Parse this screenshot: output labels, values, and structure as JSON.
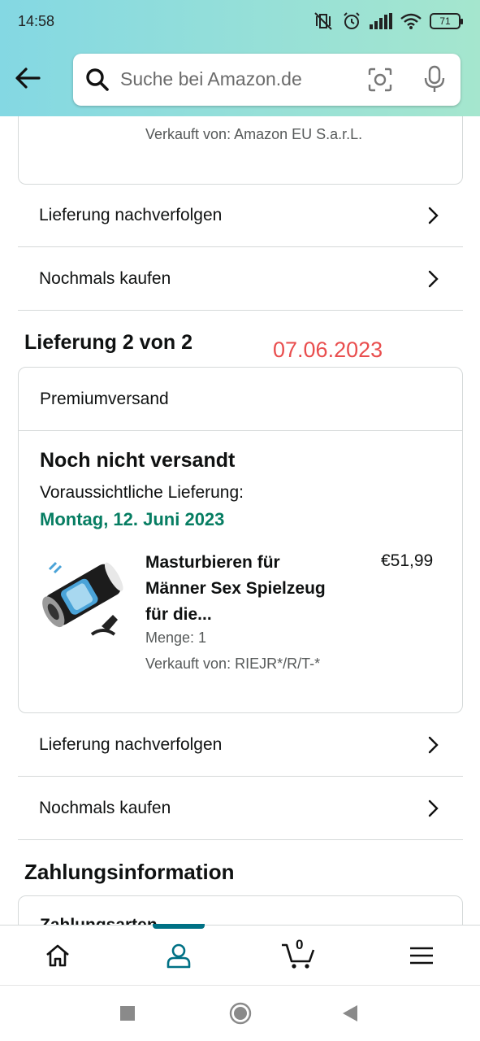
{
  "status_bar": {
    "time": "14:58",
    "battery": "71"
  },
  "search": {
    "placeholder": "Suche bei Amazon.de"
  },
  "delivery1": {
    "seller": "Verkauft von: Amazon EU S.a.r.L.",
    "track_label": "Lieferung nachverfolgen",
    "buy_again_label": "Nochmals kaufen"
  },
  "delivery2": {
    "title": "Lieferung 2 von 2",
    "annotation_date": "07.06.2023",
    "shipping_type": "Premiumversand",
    "status": "Noch nicht versandt",
    "expected_label": "Voraussichtliche Lieferung:",
    "expected_date": "Montag, 12. Juni 2023",
    "product": {
      "title": "Masturbieren für Männer Sex Spielzeug für die...",
      "price": "€51,99",
      "quantity": "Menge: 1",
      "seller": "Verkauft von: RIEJR*/R/T-*"
    },
    "track_label": "Lieferung nachverfolgen",
    "buy_again_label": "Nochmals kaufen"
  },
  "payment": {
    "title": "Zahlungsinformation",
    "methods_label": "Zahlungsarten"
  },
  "bottom_nav": {
    "cart_count": "0"
  },
  "colors": {
    "header_start": "#84d8e3",
    "header_end": "#a5e6ce",
    "delivery_green": "#067d62",
    "annotation_red": "#e94e4e",
    "nav_accent": "#007185"
  }
}
